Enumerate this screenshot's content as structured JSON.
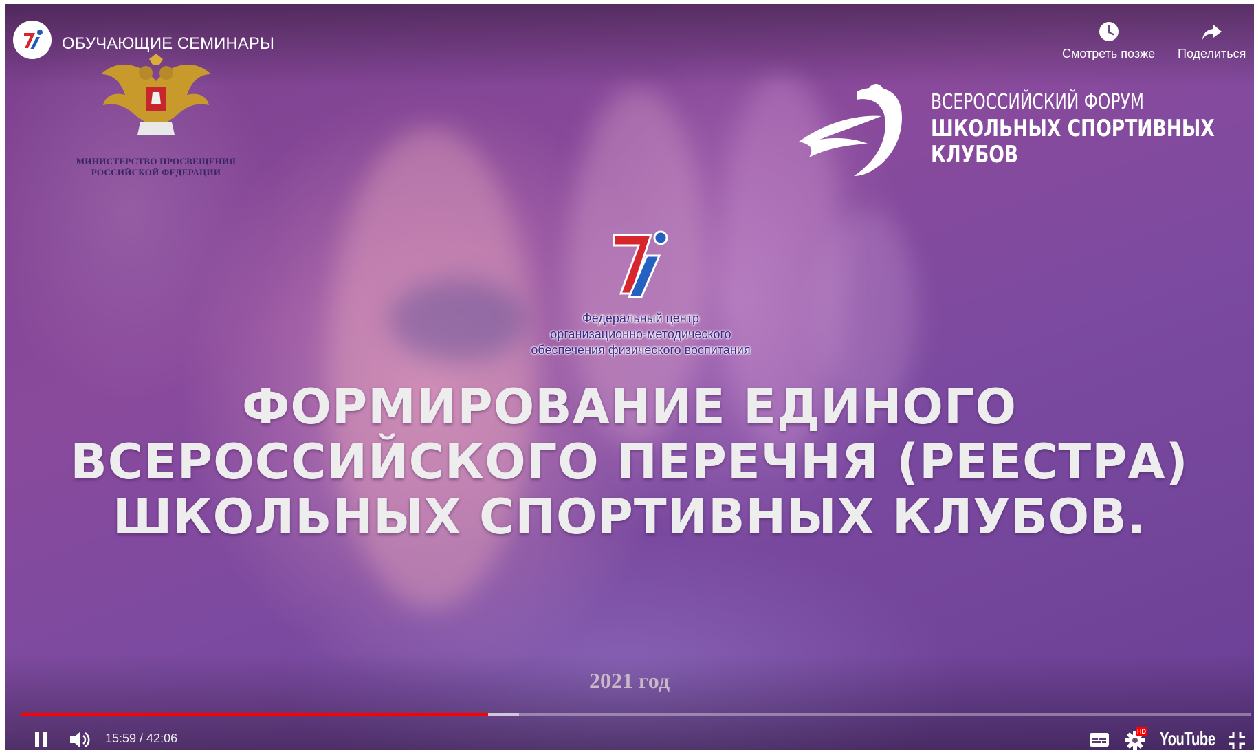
{
  "header": {
    "title": "ОБУЧАЮЩИЕ СЕМИНАРЫ",
    "avatar_icon": "channel-7i-logo-icon",
    "watch_later_label": "Смотреть позже",
    "share_label": "Поделиться"
  },
  "slide": {
    "ministry_line1": "МИНИСТЕРСТВО ПРОСВЕЩЕНИЯ",
    "ministry_line2": "РОССИЙСКОЙ ФЕДЕРАЦИИ",
    "forum_line1": "ВСЕРОССИЙСКИЙ ФОРУМ",
    "forum_line2": "ШКОЛЬНЫХ СПОРТИВНЫХ",
    "forum_line3": "КЛУБОВ",
    "center_line1": "Федеральный центр",
    "center_line2": "организационно-методического",
    "center_line3": "обеспечения физического воспитания",
    "headline_line1": "ФОРМИРОВАНИЕ ЕДИНОГО",
    "headline_line2": "ВСЕРОССИЙСКОГО ПЕРЕЧНЯ (РЕЕСТРА)",
    "headline_line3": "ШКОЛЬНЫХ СПОРТИВНЫХ КЛУБОВ.",
    "year": "2021 год"
  },
  "player": {
    "time_display": "15:59 / 42:06",
    "played_fraction": 0.38,
    "buffered_fraction": 0.405,
    "brand_wordmark": "YouTube",
    "hd_badge": "HD",
    "progress_color": "#ff0000",
    "controls": [
      "pause-icon",
      "volume-icon",
      "subtitles-icon",
      "settings-gear-icon",
      "exit-fullscreen-icon"
    ]
  }
}
